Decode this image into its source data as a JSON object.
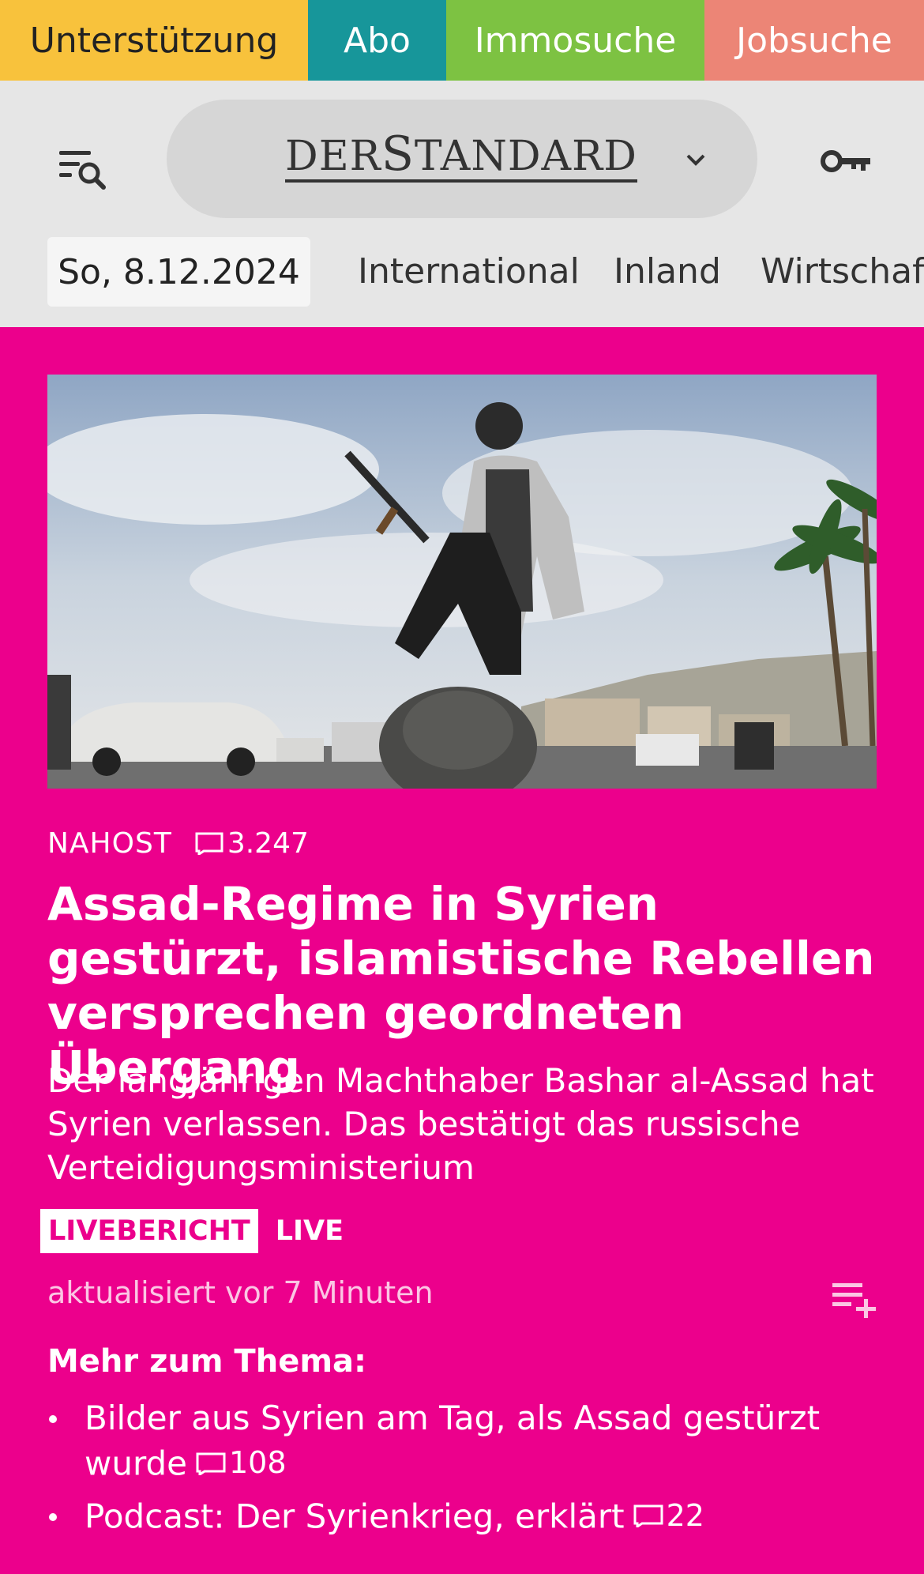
{
  "topbar": {
    "support": "Unterstützung",
    "abo": "Abo",
    "immo": "Immosuche",
    "jobs": "Jobsuche"
  },
  "header": {
    "logo_a": "DER",
    "logo_b": "S",
    "logo_c": "TANDARD",
    "date": "So, 8.12.2024",
    "nav": [
      "International",
      "Inland",
      "Wirtschaft"
    ]
  },
  "article": {
    "section": "NAHOST",
    "comments": "3.247",
    "headline": "Assad-Regime in Syrien gestürzt, islamistische Rebellen versprechen geordneten Übergang",
    "teaser": "Der langjährigen Machthaber Bashar al-Assad hat Syrien verlassen. Das bestätigt das russische Vertei­digungsministerium",
    "badge": "LIVEBERICHT",
    "live": "LIVE",
    "updated": "aktualisiert vor 7 Minuten"
  },
  "more": {
    "title": "Mehr zum Thema:",
    "items": [
      {
        "text": "Bilder aus Syrien am Tag, als Assad gestürzt wurde",
        "comments": "108"
      },
      {
        "text": "Podcast: Der Syrienkrieg, erklärt",
        "comments": "22"
      }
    ]
  },
  "colors": {
    "accent": "#ec008c",
    "support": "#f8c23c",
    "abo": "#17969a",
    "immo": "#7dc242",
    "jobs": "#ec8576"
  },
  "icons": {
    "menu": "menu-search-icon",
    "chevron": "chevron-down-icon",
    "key": "key-icon",
    "comment": "comment-icon",
    "playlist": "playlist-add-icon"
  }
}
